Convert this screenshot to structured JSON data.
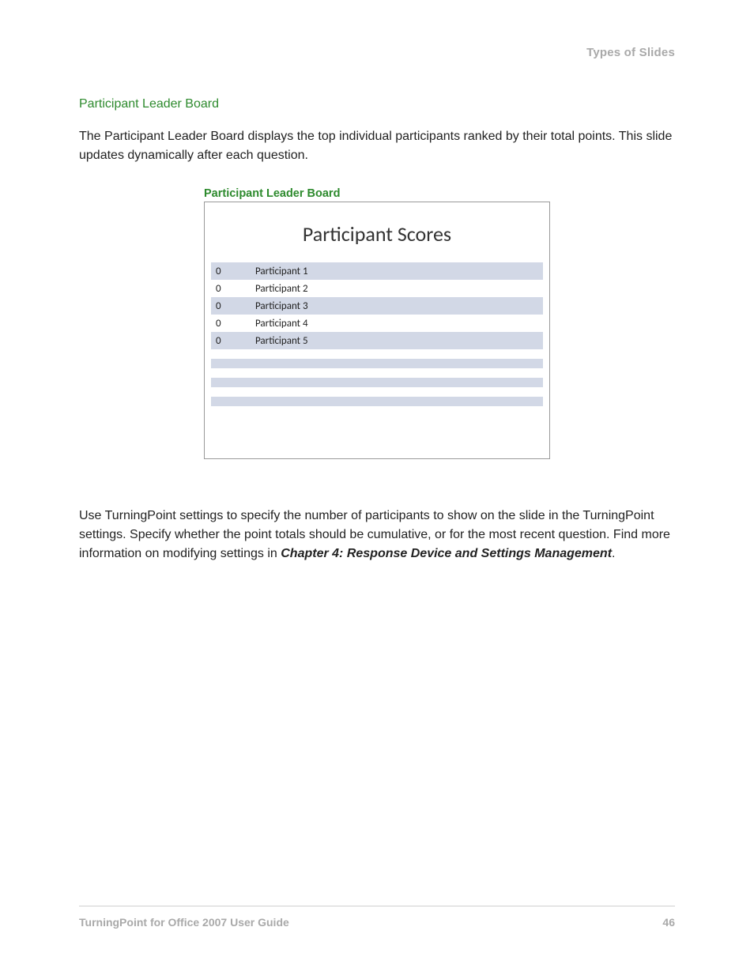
{
  "header": {
    "section": "Types of Slides"
  },
  "section": {
    "heading": "Participant Leader Board",
    "intro": "The Participant Leader Board displays the top individual participants ranked by their total points. This slide updates dynamically after each question."
  },
  "figure": {
    "caption": "Participant Leader Board",
    "slide_title": "Participant Scores",
    "rows": [
      {
        "score": "0",
        "name": "Participant 1"
      },
      {
        "score": "0",
        "name": "Participant 2"
      },
      {
        "score": "0",
        "name": "Participant 3"
      },
      {
        "score": "0",
        "name": "Participant 4"
      },
      {
        "score": "0",
        "name": "Participant 5"
      }
    ]
  },
  "after": {
    "text_a": "Use TurningPoint settings to specify the number of participants to show on the slide in the TurningPoint settings. Specify whether the point totals should be cumulative, or for the most recent question. Find more information on modifying settings in ",
    "chapter_ref": "Chapter 4: Response Device and Settings Management",
    "text_b": "."
  },
  "footer": {
    "guide": "TurningPoint for Office 2007 User Guide",
    "page": "46"
  }
}
